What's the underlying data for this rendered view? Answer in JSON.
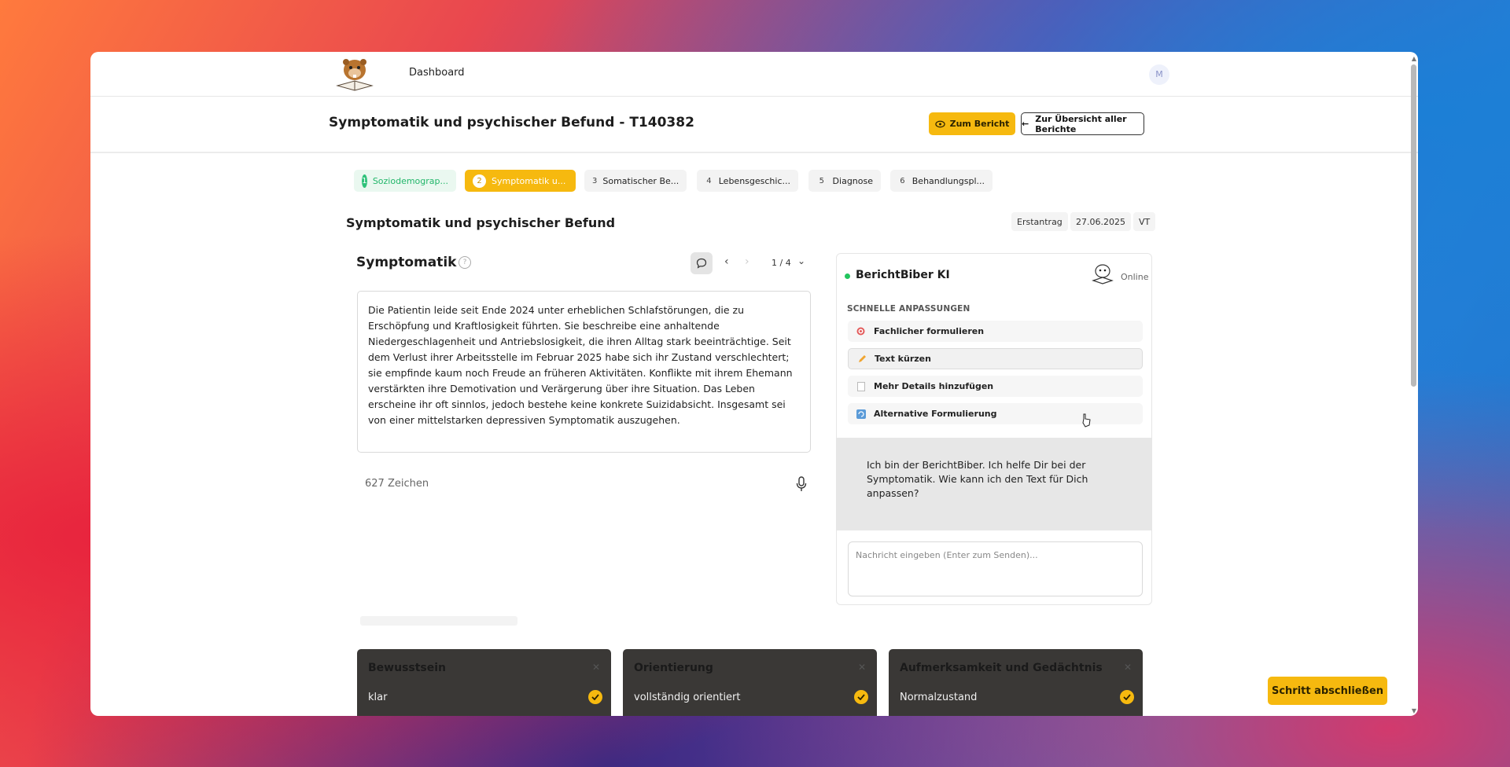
{
  "topbar": {
    "nav_dashboard": "Dashboard",
    "avatar_initial": "M"
  },
  "header": {
    "title": "Symptomatik und psychischer Befund - T140382",
    "report_button": "Zum Bericht",
    "all_reports_button": "Zur Übersicht aller Berichte"
  },
  "steps": [
    {
      "num": "1",
      "label": "Soziodemograp...",
      "state": "done"
    },
    {
      "num": "2",
      "label": "Symptomatik u...",
      "state": "active"
    },
    {
      "num": "3",
      "label": "Somatischer Be...",
      "state": "todo"
    },
    {
      "num": "4",
      "label": "Lebensgeschic...",
      "state": "todo"
    },
    {
      "num": "5",
      "label": "Diagnose",
      "state": "todo"
    },
    {
      "num": "6",
      "label": "Behandlungspl...",
      "state": "todo"
    }
  ],
  "section": {
    "title": "Symptomatik und psychischer Befund",
    "meta_type": "Erstantrag",
    "meta_date": "27.06.2025",
    "meta_kind": "VT"
  },
  "editor": {
    "heading": "Symptomatik",
    "help_icon": "question-circle-icon",
    "pagination": "1 / 4",
    "text": "Die Patientin leide seit Ende 2024 unter erheblichen Schlafstörungen, die zu Erschöpfung und Kraftlosigkeit führten. Sie beschreibe eine anhaltende Niedergeschlagenheit und Antriebslosigkeit, die ihren Alltag stark beeinträchtige. Seit dem Verlust ihrer Arbeitsstelle im Februar 2025 habe sich ihr Zustand verschlechtert; sie empfinde kaum noch Freude an früheren Aktivitäten. Konflikte mit ihrem Ehemann verstärkten ihre Demotivation und Verärgerung über ihre Situation. Das Leben erscheine ihr oft sinnlos, jedoch bestehe keine konkrete Suizidabsicht. Insgesamt sei von einer mittelstarken depressiven Symptomatik auszugehen.",
    "char_count": "627 Zeichen"
  },
  "ai": {
    "title": "BerichtBiber KI",
    "status": "Online",
    "quick_label": "SCHNELLE ANPASSUNGEN",
    "quick": [
      {
        "label": "Fachlicher formulieren",
        "icon": "target-icon"
      },
      {
        "label": "Text kürzen",
        "icon": "pencil-icon"
      },
      {
        "label": "Mehr Details hinzufügen",
        "icon": "document-icon"
      },
      {
        "label": "Alternative Formulierung",
        "icon": "refresh-icon"
      }
    ],
    "message": "Ich bin der BerichtBiber. Ich helfe Dir bei der Symptomatik. Wie kann ich den Text für Dich anpassen?",
    "input_placeholder": "Nachricht eingeben (Enter zum Senden)..."
  },
  "cards": [
    {
      "title": "Bewusstsein",
      "value": "klar"
    },
    {
      "title": "Orientierung",
      "value": "vollständig orientiert"
    },
    {
      "title": "Aufmerksamkeit und Gedächtnis",
      "value": "Normalzustand"
    }
  ],
  "finish_button": "Schritt abschließen",
  "colors": {
    "accent": "#f6b90f",
    "success": "#2fc27a",
    "online": "#22c55e"
  }
}
